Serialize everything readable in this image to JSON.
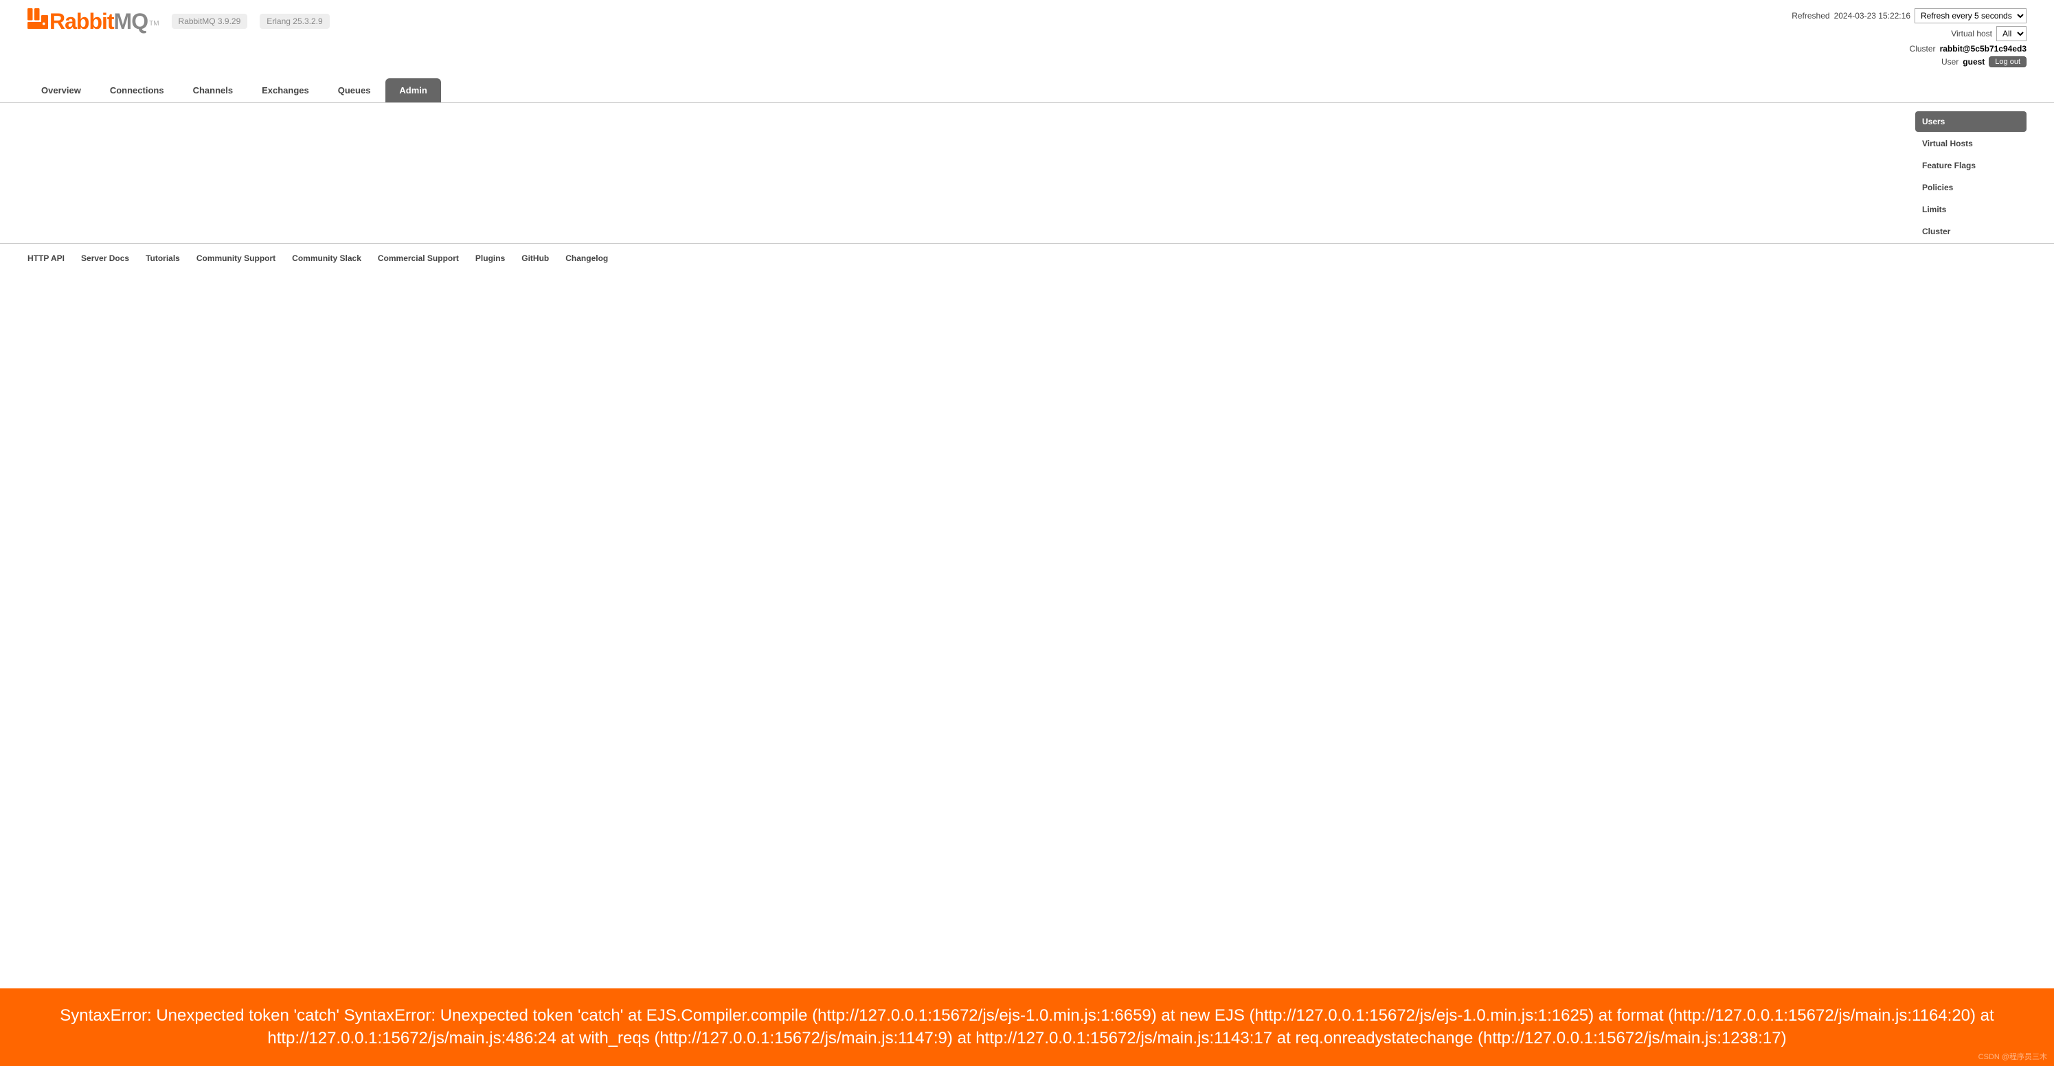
{
  "header": {
    "logo_main": "Rabbit",
    "logo_suffix": "MQ",
    "logo_tm": "TM",
    "versions": [
      "RabbitMQ 3.9.29",
      "Erlang 25.3.2.9"
    ]
  },
  "top_right": {
    "refreshed_label": "Refreshed",
    "refreshed_time": "2024-03-23 15:22:16",
    "refresh_select": "Refresh every 5 seconds",
    "vhost_label": "Virtual host",
    "vhost_value": "All",
    "cluster_label": "Cluster",
    "cluster_value": "rabbit@5c5b71c94ed3",
    "user_label": "User",
    "user_value": "guest",
    "logout": "Log out"
  },
  "nav": {
    "tabs": [
      "Overview",
      "Connections",
      "Channels",
      "Exchanges",
      "Queues",
      "Admin"
    ],
    "active": 5
  },
  "sidebar": {
    "items": [
      "Users",
      "Virtual Hosts",
      "Feature Flags",
      "Policies",
      "Limits",
      "Cluster"
    ],
    "active": 0
  },
  "footer": {
    "links": [
      "HTTP API",
      "Server Docs",
      "Tutorials",
      "Community Support",
      "Community Slack",
      "Commercial Support",
      "Plugins",
      "GitHub",
      "Changelog"
    ]
  },
  "error_text": "SyntaxError: Unexpected token 'catch' SyntaxError: Unexpected token 'catch' at EJS.Compiler.compile (http://127.0.0.1:15672/js/ejs-1.0.min.js:1:6659) at new EJS (http://127.0.0.1:15672/js/ejs-1.0.min.js:1:1625) at format (http://127.0.0.1:15672/js/main.js:1164:20) at http://127.0.0.1:15672/js/main.js:486:24 at with_reqs (http://127.0.0.1:15672/js/main.js:1147:9) at http://127.0.0.1:15672/js/main.js:1143:17 at req.onreadystatechange (http://127.0.0.1:15672/js/main.js:1238:17)",
  "watermark": "CSDN @程序员三木"
}
